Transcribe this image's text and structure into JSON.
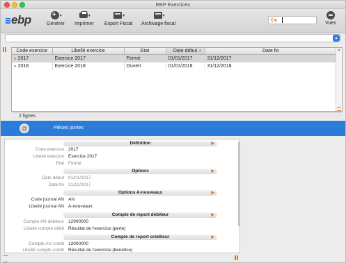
{
  "window": {
    "title": "EBP Exercices"
  },
  "logo": {
    "text": "ebp"
  },
  "toolbar": {
    "generer": "Générer",
    "imprimer": "Imprimer",
    "export_fiscal": "Export Fiscal",
    "archivage_fiscal": "Archivage fiscal",
    "vues": "Vues",
    "search_value": ""
  },
  "grid": {
    "columns": [
      "Code exercice",
      "Libellé exercice",
      "Etat",
      "Date début",
      "Date fin"
    ],
    "sorted_column": "Date début",
    "rows": [
      {
        "code": "2017",
        "libelle": "Exercice 2017",
        "etat": "Fermé",
        "debut": "01/01/2017",
        "fin": "31/12/2017",
        "selected": true
      },
      {
        "code": "2018",
        "libelle": "Exercice 2018",
        "etat": "Ouvert",
        "debut": "01/01/2018",
        "fin": "31/12/2018",
        "selected": false
      }
    ],
    "count_label": "2 lignes"
  },
  "attachments": {
    "label": "Pièces jointes"
  },
  "detail": {
    "sections": {
      "definition": "Définition",
      "options": "Options",
      "options_an": "Options A-nouveaux",
      "report_debiteur": "Compte de report débiteur",
      "report_crediteur": "Compte de report créditeur"
    },
    "fields": {
      "code_exercice": {
        "label": "Code exercice",
        "value": "2017"
      },
      "libelle_exercice": {
        "label": "Libellé exercice",
        "value": "Exercice 2017"
      },
      "etat": {
        "label": "Etat",
        "value": "Fermé"
      },
      "date_debut": {
        "label": "Date début",
        "value": "01/01/2017"
      },
      "date_fin": {
        "label": "Date fin",
        "value": "31/12/2017"
      },
      "code_journal_an": {
        "label": "Code journal AN",
        "value": "AN"
      },
      "libelle_journal_an": {
        "label": "Libellé journal AN",
        "value": "A-nouveaux"
      },
      "compte_an_debiteur": {
        "label": "Compte AN débiteur",
        "value": "12900000"
      },
      "libelle_compte_debit": {
        "label": "Libellé compte débit",
        "value": "Résultat de l'exercice (perte)"
      },
      "compte_an_credit": {
        "label": "Compte AN crédit",
        "value": "12000000"
      },
      "libelle_compte_credit": {
        "label": "Libellé compte crédit",
        "value": "Résultat de l'exercice (bénéfice)"
      }
    }
  },
  "colors": {
    "accent": "#2b7bd9",
    "orange": "#e8751a",
    "selected_row": "#d6d6d6"
  }
}
